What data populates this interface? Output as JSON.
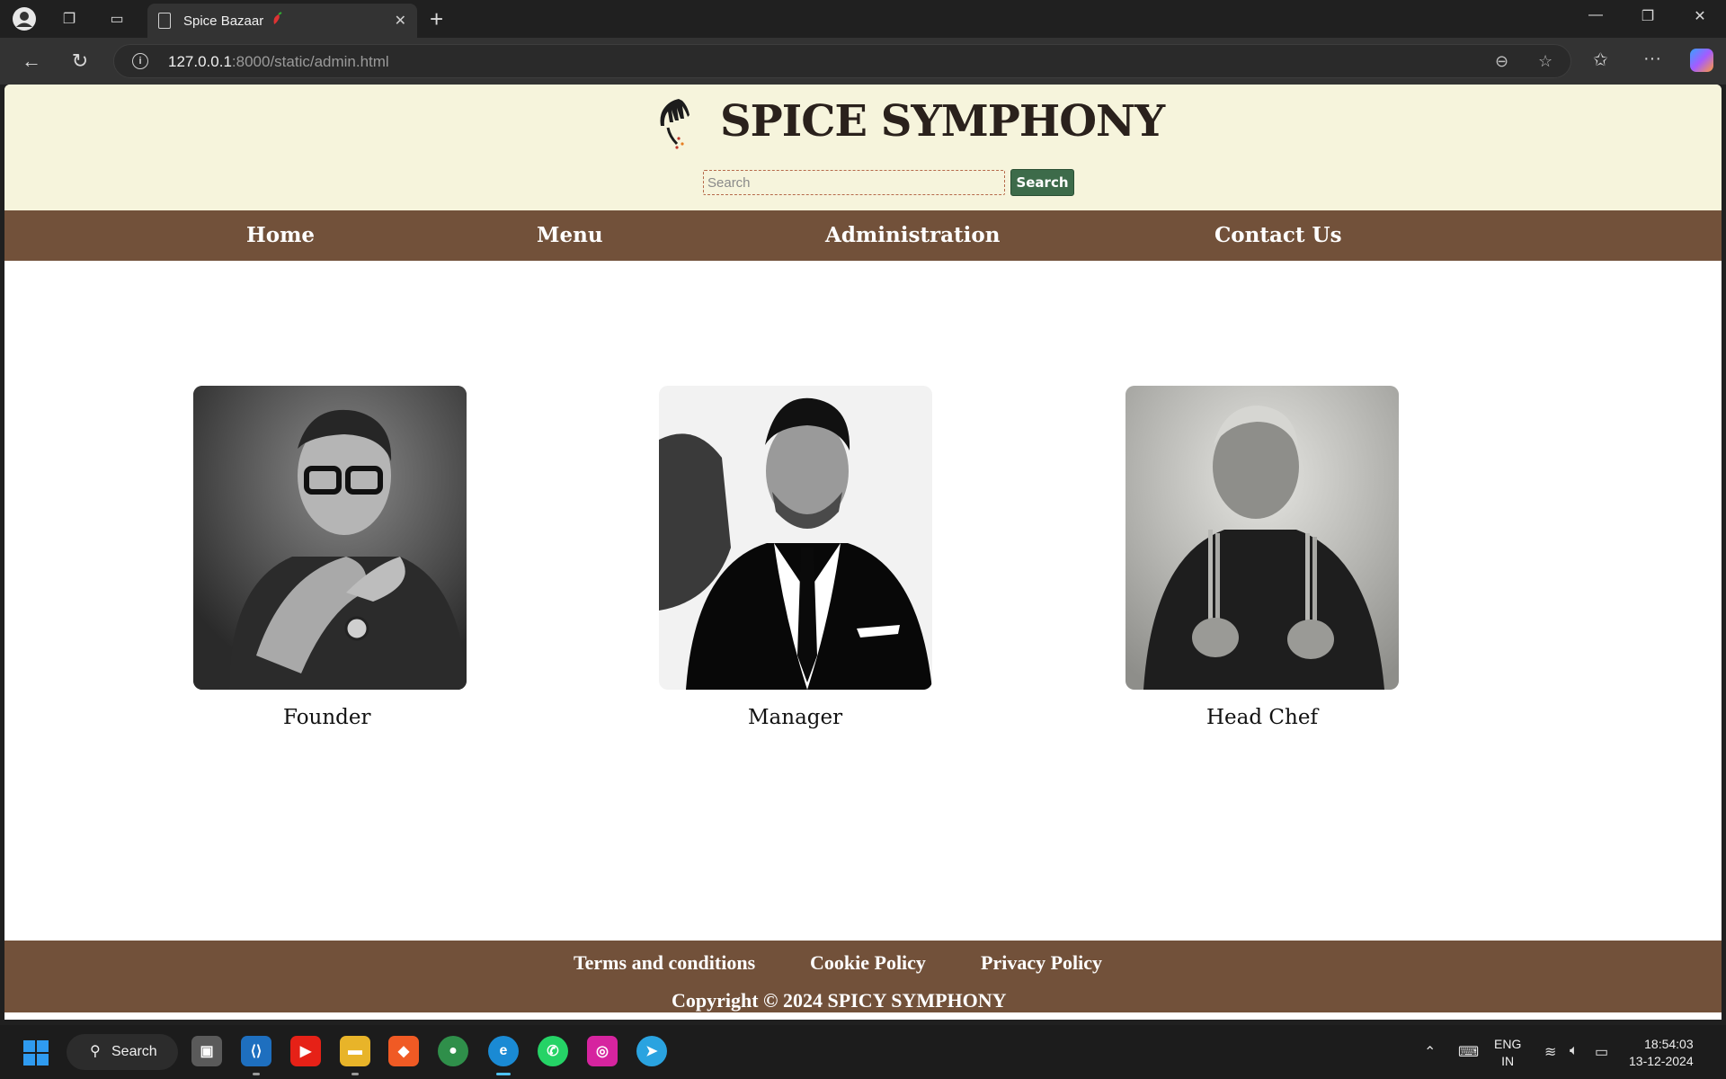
{
  "browser": {
    "tab_title": "Spice Bazaar",
    "url_host": "127.0.0.1",
    "url_rest": ":8000/static/admin.html"
  },
  "site": {
    "brand": "SPICE SYMPHONY",
    "search_placeholder": "Search",
    "search_button": "Search",
    "nav": [
      "Home",
      "Menu",
      "Administration",
      "Contact Us"
    ],
    "staff": [
      {
        "role": "Founder"
      },
      {
        "role": "Manager"
      },
      {
        "role": "Head Chef"
      }
    ],
    "footer_links": [
      "Terms and conditions",
      "Cookie Policy",
      "Privacy Policy"
    ],
    "copyright": "Copyright © 2024 SPICY SYMPHONY"
  },
  "taskbar": {
    "search_label": "Search",
    "lang_line1": "ENG",
    "lang_line2": "IN",
    "time": "18:54:03",
    "date": "13-12-2024"
  }
}
